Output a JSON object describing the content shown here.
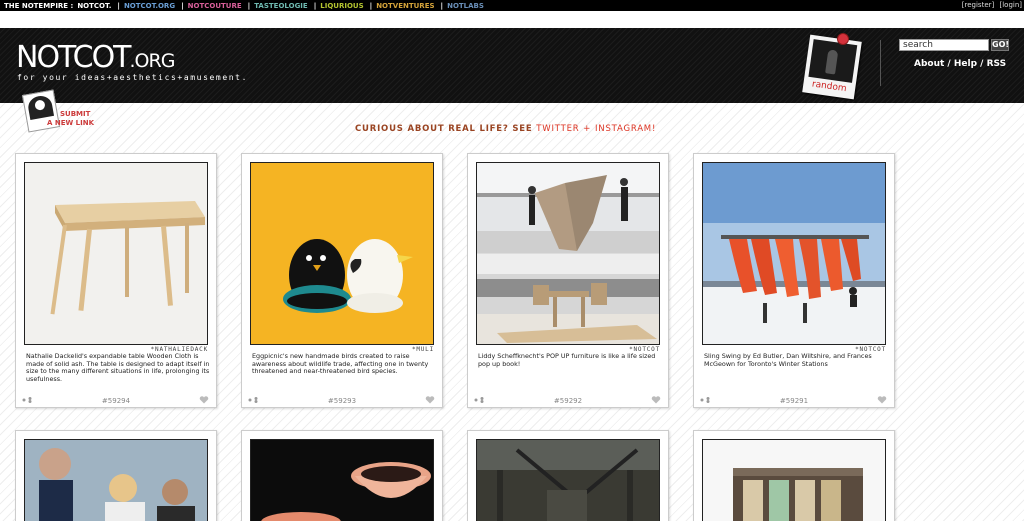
{
  "empire_bar": {
    "label": "THE NOTEMPIRE :",
    "links": [
      {
        "text": "NOTCOT.",
        "color": "#ffffff"
      },
      {
        "text": "NOTCOT.ORG",
        "color": "#6a9fd6"
      },
      {
        "text": "NOTCOUTURE",
        "color": "#d9609a"
      },
      {
        "text": "TASTEOLOGIE",
        "color": "#6fb9b0"
      },
      {
        "text": "LIQURIOUS",
        "color": "#b5c430"
      },
      {
        "text": "NOTVENTURES",
        "color": "#d4a33a"
      },
      {
        "text": "NOTLABS",
        "color": "#6a8fb8"
      }
    ],
    "register": "[register]",
    "login": "[login]"
  },
  "header": {
    "logo_main": "NOTCOT",
    "logo_org": ".ORG",
    "tagline": "for your ideas+aesthetics+amusement.",
    "random_label": "random",
    "search_placeholder": "search",
    "go_label": "GO!",
    "links": "About / Help / RSS"
  },
  "submit": {
    "line1": "SUBMIT",
    "line2": "A NEW LINK"
  },
  "promo": {
    "text": "CURIOUS ABOUT REAL LIFE? SEE",
    "twitter": "TWITTER",
    "plus": "+",
    "instagram": "INSTAGRAM!"
  },
  "cards": [
    {
      "credit": "*NATHALIEDACK",
      "desc": "Nathalie Dackelid's expandable table Wooden Cloth is made of solid ash. The table is designed to adapt itself in size to the many different situations in life, prolonging its usefulness.",
      "num": "#59294"
    },
    {
      "credit": "*MULI",
      "desc": "Eggpicnic's new handmade birds created to raise awareness about wildlife trade, affecting one in twenty threatened and near-threatened bird species.",
      "num": "#59293"
    },
    {
      "credit": "*NOTCOT",
      "desc": "Liddy Scheffknecht's POP UP furniture is like a life sized pop up book!",
      "num": "#59292"
    },
    {
      "credit": "*NOTCOT",
      "desc": "Sling Swing by Ed Butler, Dan Wiltshire, and Frances McGeown for Toronto's Winter Stations",
      "num": "#59291"
    }
  ]
}
